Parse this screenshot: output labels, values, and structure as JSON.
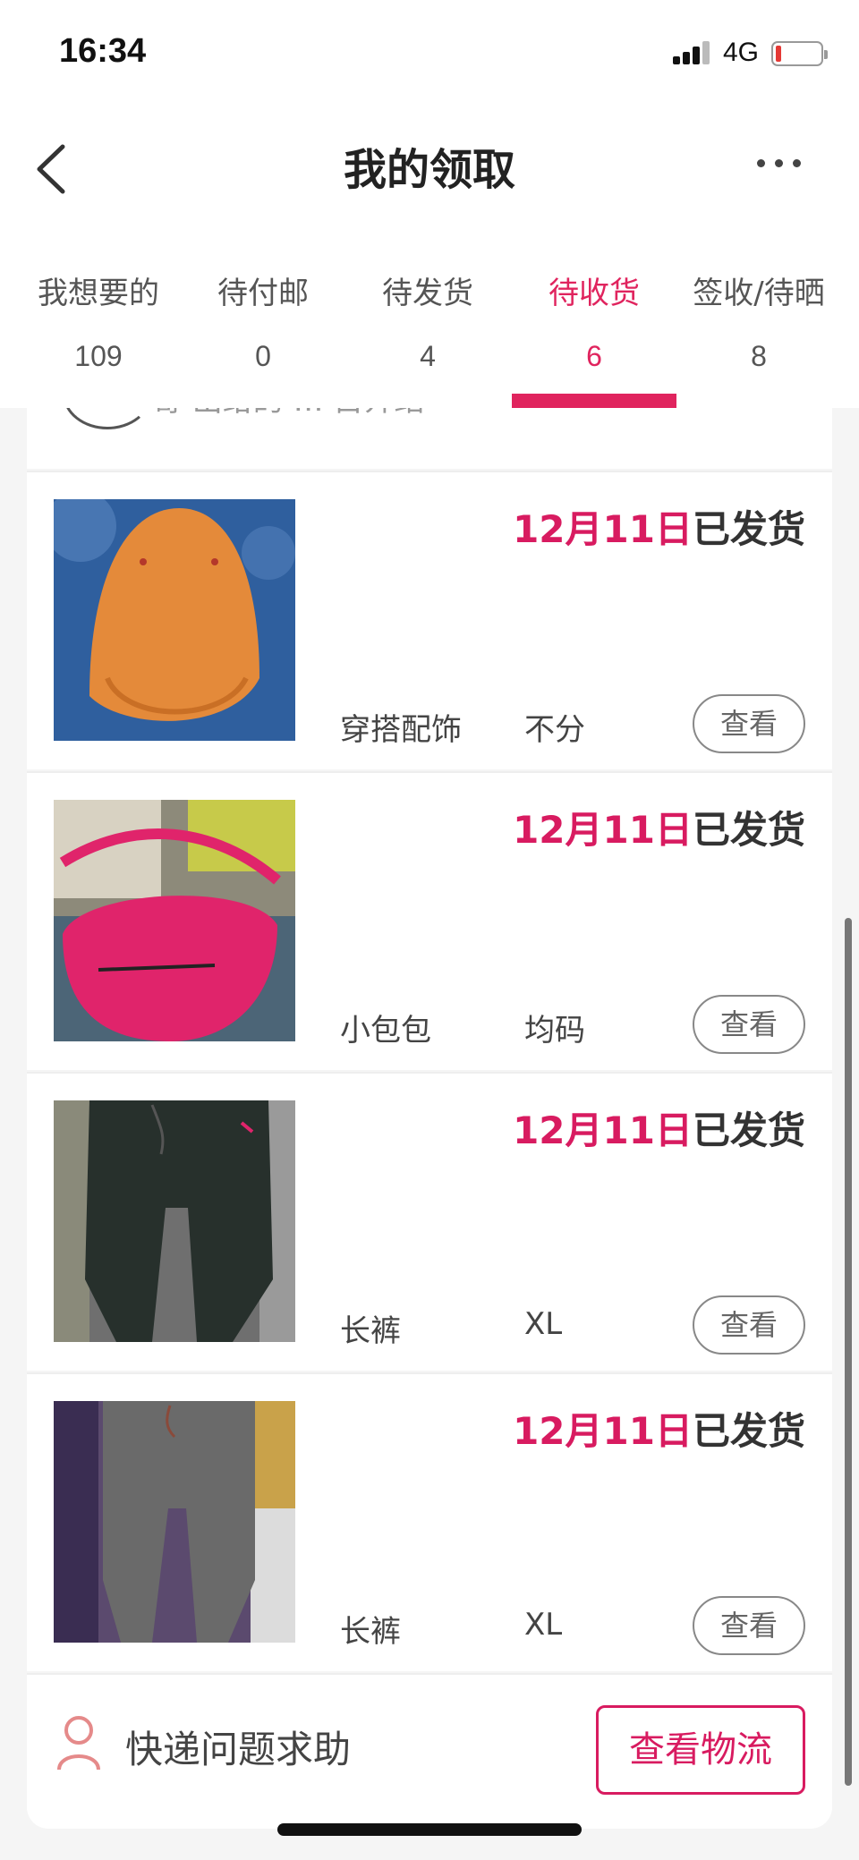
{
  "status": {
    "time": "16:34",
    "network": "4G"
  },
  "nav": {
    "title": "我的领取"
  },
  "tabs": [
    {
      "label": "我想要的",
      "count": "109"
    },
    {
      "label": "待付邮",
      "count": "0"
    },
    {
      "label": "待发货",
      "count": "4"
    },
    {
      "label": "待收货",
      "count": "6",
      "active": true
    },
    {
      "label": "签收/待晒",
      "count": "8"
    }
  ],
  "partial_text": "寄 出给的 … 目介绍",
  "items": [
    {
      "date": "12月11日",
      "status": "已发货",
      "category": "穿搭配饰",
      "size": "不分",
      "button": "查看",
      "image": "orange-cap"
    },
    {
      "date": "12月11日",
      "status": "已发货",
      "category": "小包包",
      "size": "均码",
      "button": "查看",
      "image": "pink-bag"
    },
    {
      "date": "12月11日",
      "status": "已发货",
      "category": "长裤",
      "size": "XL",
      "button": "查看",
      "image": "dark-pants"
    },
    {
      "date": "12月11日",
      "status": "已发货",
      "category": "长裤",
      "size": "XL",
      "button": "查看",
      "image": "grey-pants"
    }
  ],
  "footer": {
    "help": "快递问题求助",
    "logistics": "查看物流"
  },
  "colors": {
    "accent": "#e0245e",
    "date": "#d81b60"
  }
}
